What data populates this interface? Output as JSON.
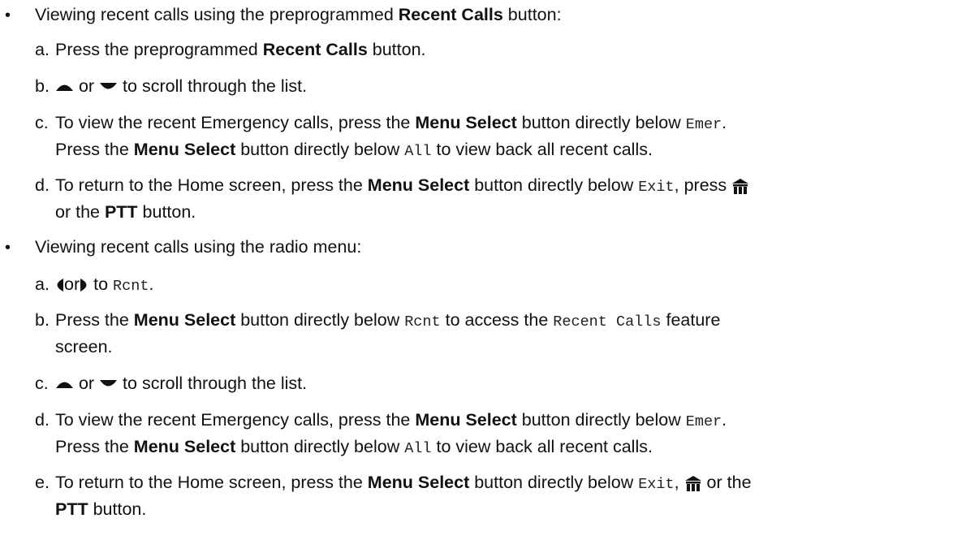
{
  "doc": {
    "bullet_symbol": "•",
    "section1": {
      "intro_pre": "Viewing recent calls using the preprogrammed ",
      "intro_bold": "Recent Calls",
      "intro_post": " button:",
      "a_label": "a.",
      "a_pre": "Press the preprogrammed ",
      "a_bold": "Recent Calls",
      "a_post": " button.",
      "b_label": "b.",
      "b_or": " or ",
      "b_post": " to scroll through the list.",
      "c_label": "c.",
      "c_l1_pre": "To view the recent Emergency calls, press the ",
      "c_l1_bold": "Menu Select",
      "c_l1_mid": " button directly below ",
      "c_l1_code": "Emer",
      "c_l1_post": ".",
      "c_l2_pre": "Press the ",
      "c_l2_bold": "Menu Select",
      "c_l2_mid": " button directly below ",
      "c_l2_code": "All",
      "c_l2_post": " to view back all recent calls.",
      "d_label": "d.",
      "d_l1_pre": "To return to the Home screen, press the ",
      "d_l1_bold": "Menu Select",
      "d_l1_mid": " button directly below ",
      "d_l1_code": "Exit",
      "d_l1_post": ", press ",
      "d_l2_pre": "or the ",
      "d_l2_bold": "PTT",
      "d_l2_post": " button."
    },
    "section2": {
      "intro": "Viewing recent calls using the radio menu:",
      "a_label": "a.",
      "a_or": "or",
      "a_to": " to ",
      "a_code": "Rcnt",
      "a_post": ".",
      "b_label": "b.",
      "b_pre": "Press the ",
      "b_bold": "Menu Select",
      "b_mid": " button directly below ",
      "b_code1": "Rcnt",
      "b_mid2": " to access the ",
      "b_code2": "Recent Calls",
      "b_post": " feature",
      "b_l2": "screen.",
      "c_label": "c.",
      "c_or": " or ",
      "c_post": " to scroll through the list.",
      "d_label": "d.",
      "d_l1_pre": "To view the recent Emergency calls, press the ",
      "d_l1_bold": "Menu Select",
      "d_l1_mid": " button directly below ",
      "d_l1_code": "Emer",
      "d_l1_post": ".",
      "d_l2_pre": "Press the ",
      "d_l2_bold": "Menu Select",
      "d_l2_mid": " button directly below ",
      "d_l2_code": "All",
      "d_l2_post": " to view back all recent calls.",
      "e_label": "e.",
      "e_l1_pre": "To return to the Home screen, press the ",
      "e_l1_bold": "Menu Select",
      "e_l1_mid": " button directly below ",
      "e_l1_code": "Exit",
      "e_l1_post": ", ",
      "e_l1_post2": " or the",
      "e_l2_bold": "PTT",
      "e_l2_post": " button."
    },
    "icons": {
      "up": "up-arrow-icon",
      "down": "down-arrow-icon",
      "left": "left-arrow-icon",
      "right": "right-arrow-icon",
      "home": "home-icon"
    }
  }
}
